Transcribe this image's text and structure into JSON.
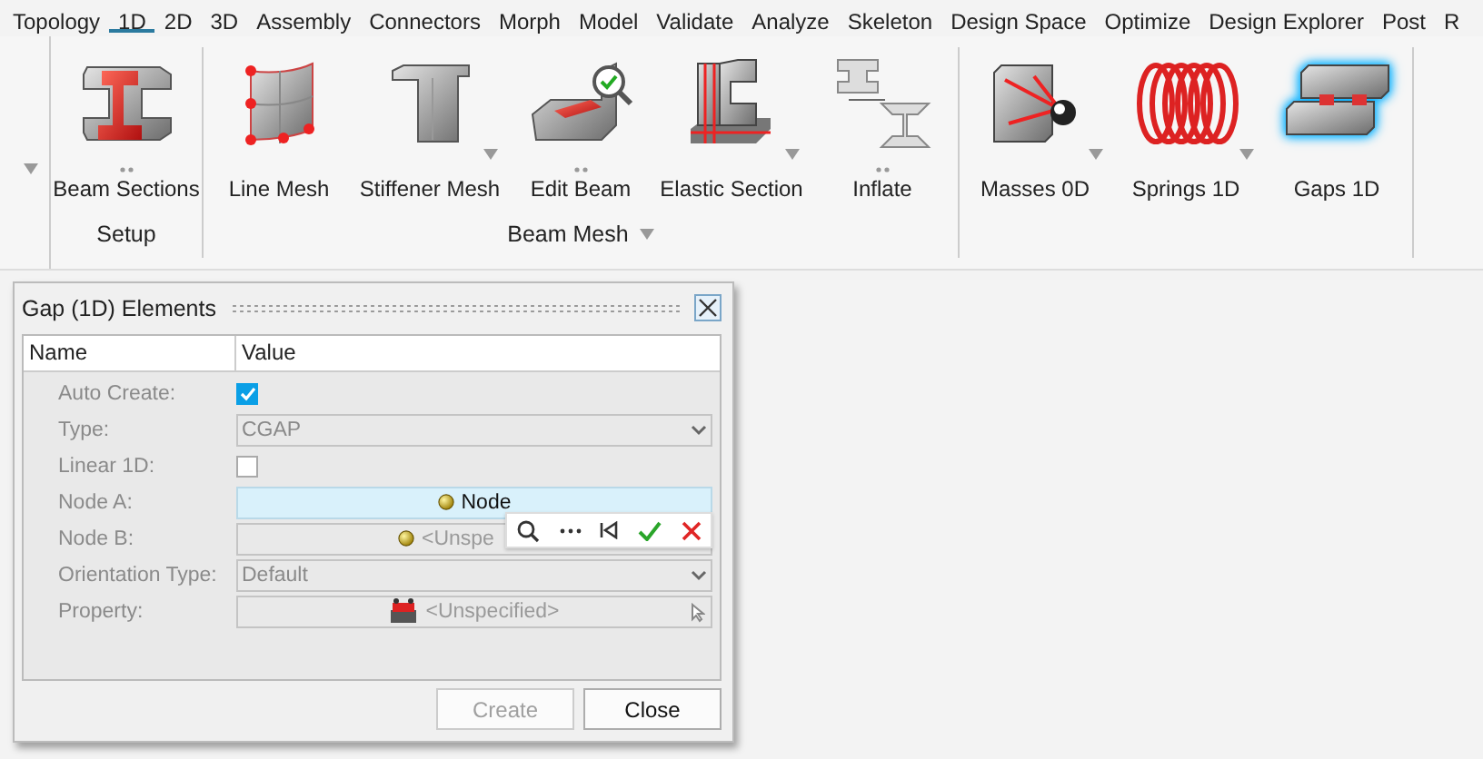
{
  "menu_tabs": [
    {
      "label": "Topology",
      "selected": false
    },
    {
      "label": "1D",
      "selected": true
    },
    {
      "label": "2D",
      "selected": false
    },
    {
      "label": "3D",
      "selected": false
    },
    {
      "label": "Assembly",
      "selected": false
    },
    {
      "label": "Connectors",
      "selected": false
    },
    {
      "label": "Morph",
      "selected": false
    },
    {
      "label": "Model",
      "selected": false
    },
    {
      "label": "Validate",
      "selected": false
    },
    {
      "label": "Analyze",
      "selected": false
    },
    {
      "label": "Skeleton",
      "selected": false
    },
    {
      "label": "Design Space",
      "selected": false
    },
    {
      "label": "Optimize",
      "selected": false
    },
    {
      "label": "Design Explorer",
      "selected": false
    },
    {
      "label": "Post",
      "selected": false
    },
    {
      "label": "R",
      "selected": false
    }
  ],
  "ribbon_groups": [
    {
      "label": "Setup",
      "items": [
        {
          "label": "Beam Sections",
          "dots": true,
          "caret": false,
          "selected": false
        }
      ]
    },
    {
      "label": "Beam Mesh",
      "caret": true,
      "items": [
        {
          "label": "Line Mesh",
          "dots": false,
          "caret": false,
          "selected": false
        },
        {
          "label": "Stiffener Mesh",
          "dots": false,
          "caret": true,
          "selected": false
        },
        {
          "label": "Edit Beam",
          "dots": true,
          "caret": false,
          "selected": false
        },
        {
          "label": "Elastic Section",
          "dots": false,
          "caret": true,
          "selected": false
        },
        {
          "label": "Inflate",
          "dots": true,
          "caret": false,
          "selected": false
        }
      ]
    },
    {
      "items": [
        {
          "label": "Masses 0D",
          "dots": false,
          "caret": true,
          "selected": false
        },
        {
          "label": "Springs 1D",
          "dots": false,
          "caret": true,
          "selected": false
        },
        {
          "label": "Gaps 1D",
          "dots": false,
          "caret": false,
          "selected": true
        }
      ]
    }
  ],
  "dialog": {
    "title": "Gap (1D) Elements",
    "columns": [
      "Name",
      "Value"
    ],
    "rows": [
      {
        "label": "Auto Create:",
        "kind": "checkbox",
        "checked": true
      },
      {
        "label": "Type:",
        "kind": "dropdown",
        "value": "CGAP"
      },
      {
        "label": "Linear 1D:",
        "kind": "checkbox",
        "checked": false
      },
      {
        "label": "Node A:",
        "kind": "node-selector",
        "selection": "Node",
        "active": true
      },
      {
        "label": "Node B:",
        "kind": "node-selector",
        "placeholder": "<Unspe",
        "active": false
      },
      {
        "label": "Orientation Type:",
        "kind": "dropdown",
        "value": "Default"
      },
      {
        "label": "Property:",
        "kind": "property-selector",
        "placeholder": "<Unspecified>",
        "active": false
      }
    ],
    "buttons": [
      {
        "label": "Create",
        "disabled": true
      },
      {
        "label": "Close",
        "disabled": false
      }
    ]
  }
}
